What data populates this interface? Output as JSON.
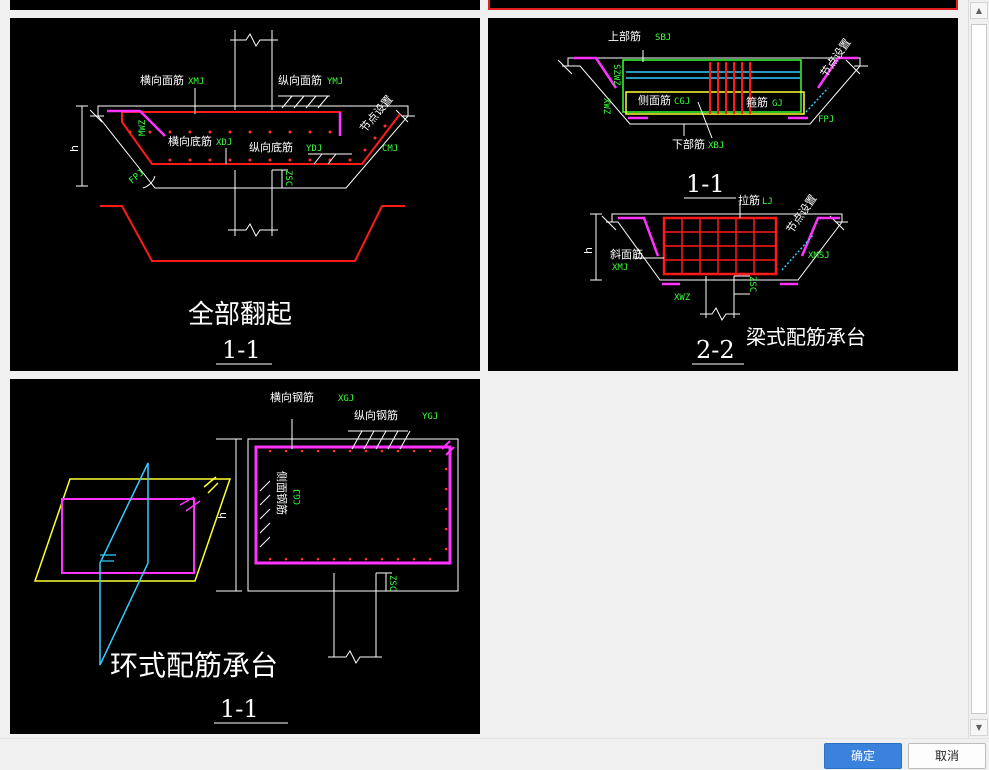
{
  "footer": {
    "ok_label": "确定",
    "cancel_label": "取消"
  },
  "scrollbar": {
    "up_glyph": "▲",
    "down_glyph": "▼"
  },
  "tile1": {
    "title": "全部翻起",
    "section": "1-1",
    "labels": {
      "xmj_cn": "横向面筋",
      "xmj_code": "XMJ",
      "ymj_cn": "纵向面筋",
      "ymj_code": "YMJ",
      "xdj_cn": "横向底筋",
      "xdj_code": "XDJ",
      "ydj_cn": "纵向底筋",
      "ydj_code": "YDJ",
      "node": "节点设置",
      "cmj": "CMJ",
      "mwz": "MWZ",
      "h": "h",
      "fpj": "FPJ",
      "zsc": "ZSC"
    }
  },
  "tile2": {
    "title": "梁式配筋承台",
    "section1": "1-1",
    "section2": "2-2",
    "labels": {
      "sbj_cn": "上部筋",
      "sbj_code": "SBJ",
      "cgj_cn": "侧面筋",
      "cgj_code": "CGJ",
      "gj_cn": "箍筋",
      "gj_code": "GJ",
      "xbj_cn": "下部筋",
      "xbj_code": "XBJ",
      "lj_cn": "拉筋",
      "lj_code": "LJ",
      "xmj_cn": "斜面筋",
      "xmj_code": "XMJ",
      "node": "节点设置",
      "fpj": "FPJ",
      "xmsj": "XMSJ",
      "xwz": "XWZ",
      "szwz": "SZWZ",
      "xwz_v": "XWZ",
      "zsc": "ZSC",
      "h": "h"
    }
  },
  "tile3": {
    "title": "环式配筋承台",
    "section": "1-1",
    "labels": {
      "xgj_cn": "横向钢筋",
      "xgj_code": "XGJ",
      "ygj_cn": "纵向钢筋",
      "ygj_code": "YGJ",
      "cgj_cn": "侧面钢筋",
      "cgj_code": "CGJ",
      "h": "h",
      "zsc": "ZSC"
    }
  }
}
